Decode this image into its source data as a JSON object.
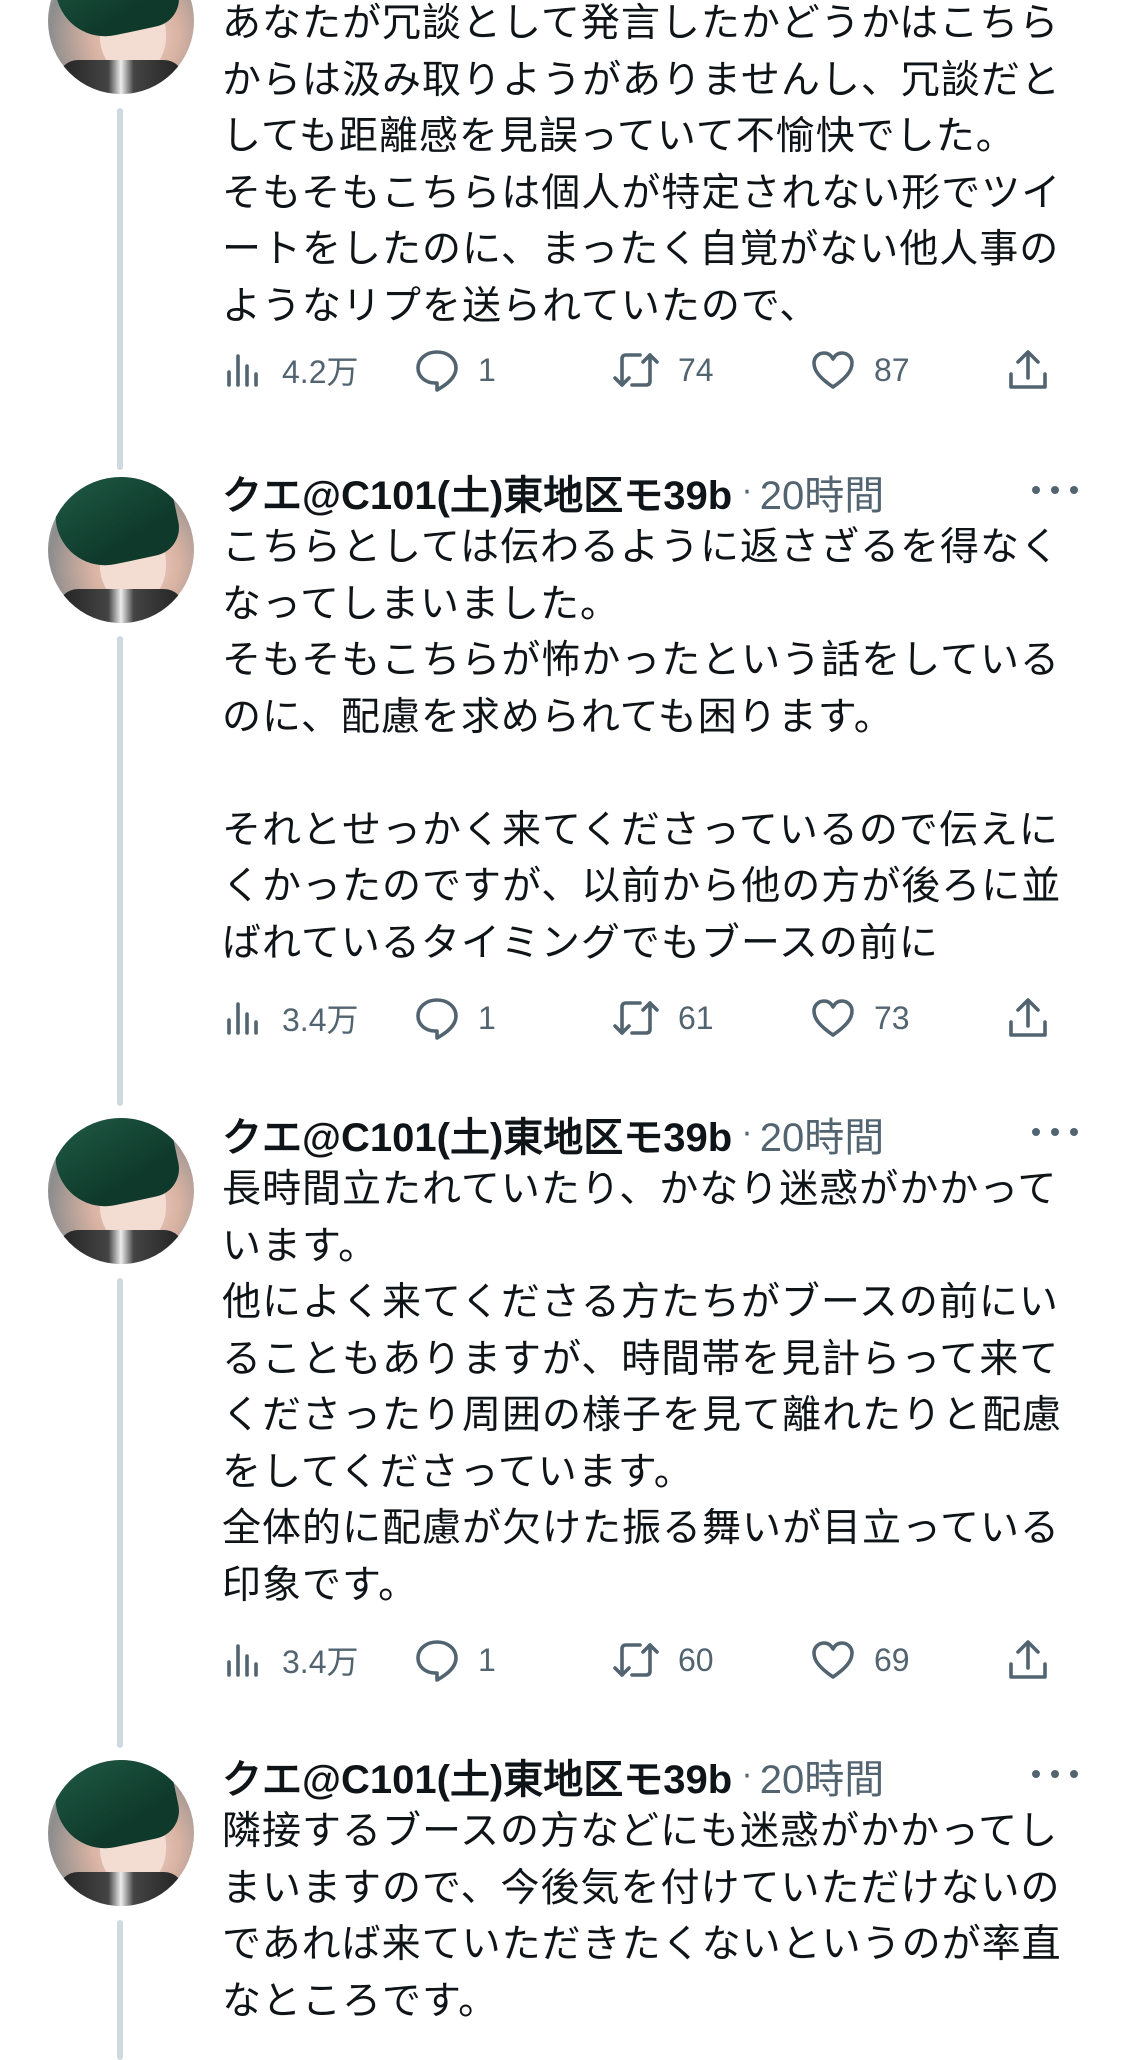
{
  "tweets": [
    {
      "name": null,
      "time": null,
      "text": "あなたが冗談として発言したかどうかはこちら\nからは汲み取りようがありませんし、冗談だと\nしても距離感を見誤っていて不愉快でした。\nそもそもこちらは個人が特定されない形でツイ\nートをしたのに、まったく自覚がない他人事の\nようなリプを送られていたので、",
      "views": "4.2万",
      "replies": "1",
      "retweets": "74",
      "likes": "87"
    },
    {
      "name": "クエ@C101(土)東地区モ39b",
      "time": "20時間",
      "text": "こちらとしては伝わるように返さざるを得なく\nなってしまいました。\nそもそもこちらが怖かったという話をしている\nのに、配慮を求められても困ります。\n\nそれとせっかく来てくださっているので伝えに\nくかったのですが、以前から他の方が後ろに並\nばれているタイミングでもブースの前に",
      "views": "3.4万",
      "replies": "1",
      "retweets": "61",
      "likes": "73"
    },
    {
      "name": "クエ@C101(土)東地区モ39b",
      "time": "20時間",
      "text": "長時間立たれていたり、かなり迷惑がかかって\nいます。\n他によく来てくださる方たちがブースの前にい\nることもありますが、時間帯を見計らって来て\nくださったり周囲の様子を見て離れたりと配慮\nをしてくださっています。\n全体的に配慮が欠けた振る舞いが目立っている\n印象です。",
      "views": "3.4万",
      "replies": "1",
      "retweets": "60",
      "likes": "69"
    },
    {
      "name": "クエ@C101(土)東地区モ39b",
      "time": "20時間",
      "text": "隣接するブースの方などにも迷惑がかかってし\nまいますので、今後気を付けていただけないの\nであれば来ていただきたくないというのが率直\nなところです。"
    }
  ],
  "icons": {
    "views": "bar-chart-icon",
    "reply": "speech-bubble-icon",
    "retweet": "retweet-arrows-icon",
    "like": "heart-icon",
    "share": "share-upload-icon",
    "more": "more-dots-icon"
  },
  "colors": {
    "text": "#0f1419",
    "secondary": "#536471",
    "thread_line": "#cfd9de",
    "background": "#ffffff"
  }
}
